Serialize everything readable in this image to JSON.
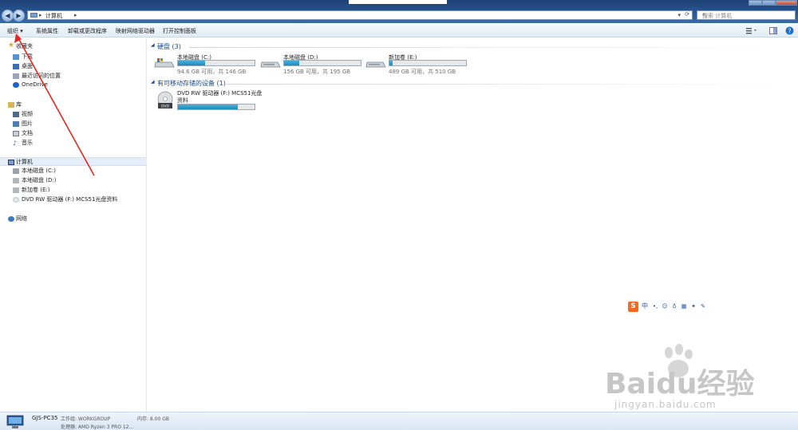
{
  "window": {
    "nav_back_icon": "back-arrow-icon",
    "nav_forward_icon": "forward-arrow-icon",
    "address_separator": "▸",
    "address_location": "计算机",
    "search_placeholder": "搜索 计算机",
    "minimize_icon": "minimize-icon",
    "maximize_icon": "maximize-icon",
    "close_icon": "close-icon"
  },
  "toolbar": {
    "organize": "组织 ▾",
    "system_properties": "系统属性",
    "uninstall": "卸载或更改程序",
    "map_drive": "映射网络驱动器",
    "control_panel": "打开控制面板"
  },
  "sidebar": {
    "favorites": {
      "label": "收藏夹",
      "items": [
        "下载",
        "桌面",
        "最近访问的位置",
        "OneDrive"
      ]
    },
    "libraries": {
      "label": "库",
      "items": [
        "视频",
        "图片",
        "文档",
        "音乐"
      ]
    },
    "computer": {
      "label": "计算机",
      "items": [
        "本地磁盘 (C:)",
        "本地磁盘 (D:)",
        "新加卷 (E:)",
        "DVD RW 驱动器 (F:) MCS51光盘资料"
      ]
    },
    "network": {
      "label": "网络"
    }
  },
  "main": {
    "hard_drives_title": "硬盘 (3)",
    "drives": [
      {
        "name": "本地磁盘 (C:)",
        "free": "94.6 GB 可用，共 146 GB",
        "used_fraction": 0.35
      },
      {
        "name": "本地磁盘 (D:)",
        "free": "156 GB 可用，共 195 GB",
        "used_fraction": 0.2
      },
      {
        "name": "新加卷 (E:)",
        "free": "489 GB 可用，共 510 GB",
        "used_fraction": 0.04
      }
    ],
    "removable_title": "有可移动存储的设备 (1)",
    "dvd": {
      "name_line1": "DVD RW 驱动器 (F:) MCS51光盘",
      "name_line2": "资料",
      "used_fraction": 0.78
    }
  },
  "status": {
    "pc_name": "GJS-PC35",
    "workgroup": "工作组: WORKGROUP",
    "memory": "内存: 8.00 GB",
    "processor": "处理器: AMD Ryzen 3 PRO 12..."
  },
  "ime": {
    "logo": "S",
    "lang": "中"
  },
  "watermark": {
    "brand": "Baidu经验",
    "url": "jingyan.baidu.com"
  },
  "colors": {
    "titlebar": "#2b5a95",
    "drive_bar": "#1a8bbd",
    "group_header": "#1a4a8a",
    "annotation_arrow": "#e0281e"
  }
}
